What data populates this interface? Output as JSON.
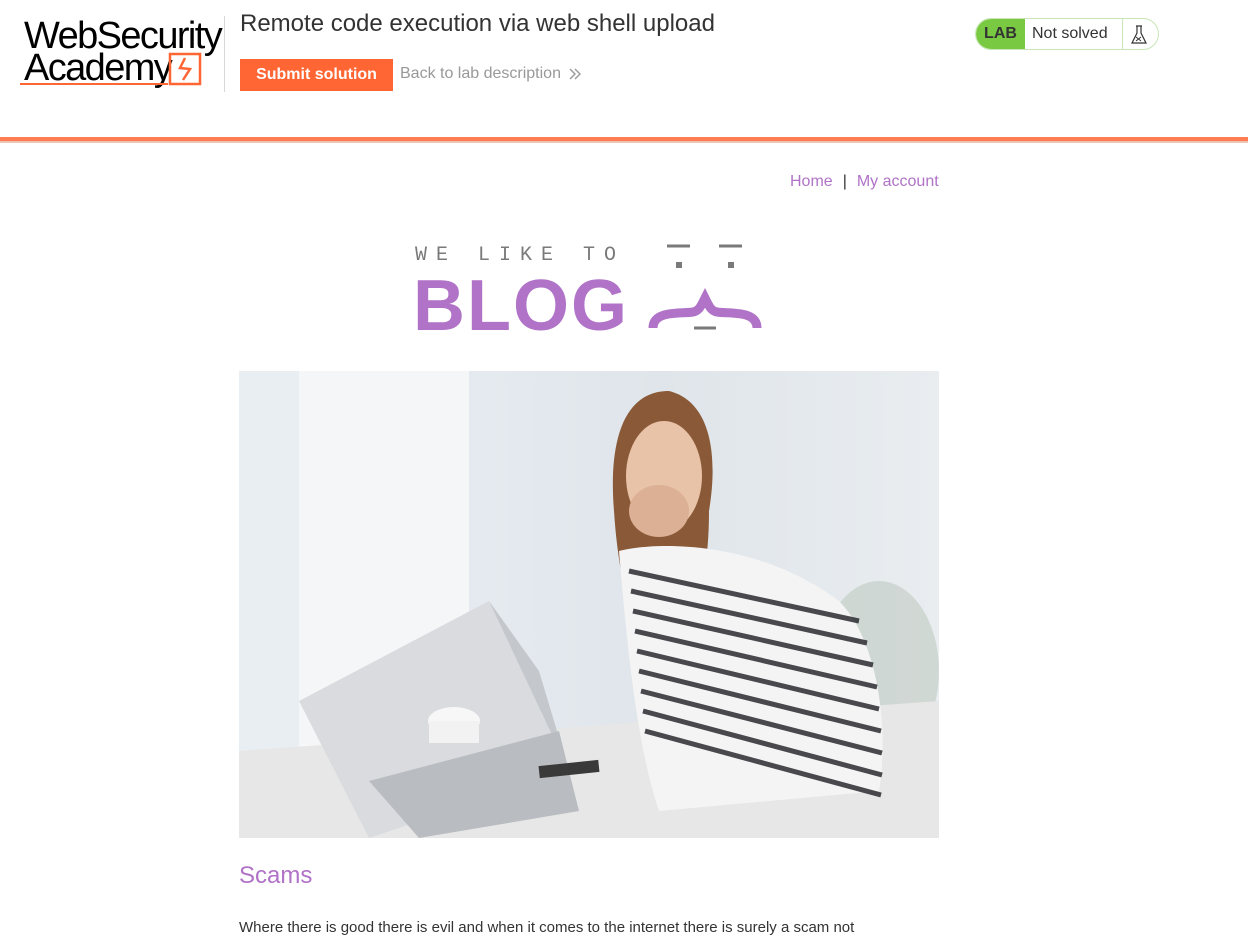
{
  "academy": {
    "logo_line1": "WebSecurity",
    "logo_line2": "Academy",
    "lab_title": "Remote code execution via web shell upload",
    "submit_label": "Submit solution",
    "back_label": "Back to lab description",
    "lab_badge": "LAB",
    "lab_status": "Not solved",
    "accent_color": "#ff6633",
    "status_color": "#7ac943"
  },
  "nav": {
    "home": "Home",
    "separator": "|",
    "account": "My account"
  },
  "blog_logo": {
    "tagline": "WE LIKE TO",
    "word": "BLOG",
    "color": "#b073c7"
  },
  "post": {
    "title": "Scams",
    "excerpt": "Where there is good there is evil and when it comes to the internet there is surely a scam not"
  }
}
